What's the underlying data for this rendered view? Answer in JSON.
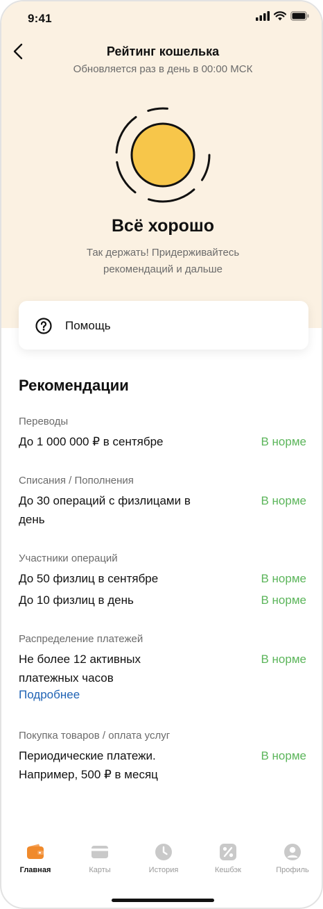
{
  "status_bar": {
    "time": "9:41"
  },
  "header": {
    "title": "Рейтинг кошелька",
    "subtitle": "Обновляется раз в день в 00:00 МСК"
  },
  "rating": {
    "status": "Всё хорошо",
    "description": "Так держать! Придерживайтесь рекомендаций и дальше",
    "color": "#f7c64a"
  },
  "help": {
    "label": "Помощь"
  },
  "recommendations": {
    "title": "Рекомендации",
    "status_color": "#5bb55a",
    "sections": [
      {
        "label": "Переводы",
        "items": [
          {
            "text": "До 1 000 000 ₽ в сентябре",
            "status": "В норме"
          }
        ]
      },
      {
        "label": "Списания / Пополнения",
        "items": [
          {
            "text": "До 30 операций с физлицами в день",
            "status": "В норме"
          }
        ]
      },
      {
        "label": "Участники операций",
        "items": [
          {
            "text": "До 50 физлиц в сентябре",
            "status": "В норме"
          },
          {
            "text": "До 10 физлиц в день",
            "status": "В норме"
          }
        ]
      },
      {
        "label": "Распределение платежей",
        "items": [
          {
            "text": "Не более 12 активных платежных часов",
            "status": "В норме"
          }
        ],
        "link": "Подробнее"
      },
      {
        "label": "Покупка товаров / оплата услуг",
        "items": [
          {
            "text": "Периодические платежи. Например, 500 ₽ в месяц",
            "status": "В норме"
          }
        ]
      }
    ]
  },
  "tabbar": {
    "items": [
      {
        "label": "Главная",
        "icon": "wallet-icon",
        "active": true
      },
      {
        "label": "Карты",
        "icon": "card-icon"
      },
      {
        "label": "История",
        "icon": "clock-icon"
      },
      {
        "label": "Кешбэк",
        "icon": "percent-icon"
      },
      {
        "label": "Профиль",
        "icon": "profile-icon"
      }
    ],
    "accent": "#f08a2c"
  }
}
